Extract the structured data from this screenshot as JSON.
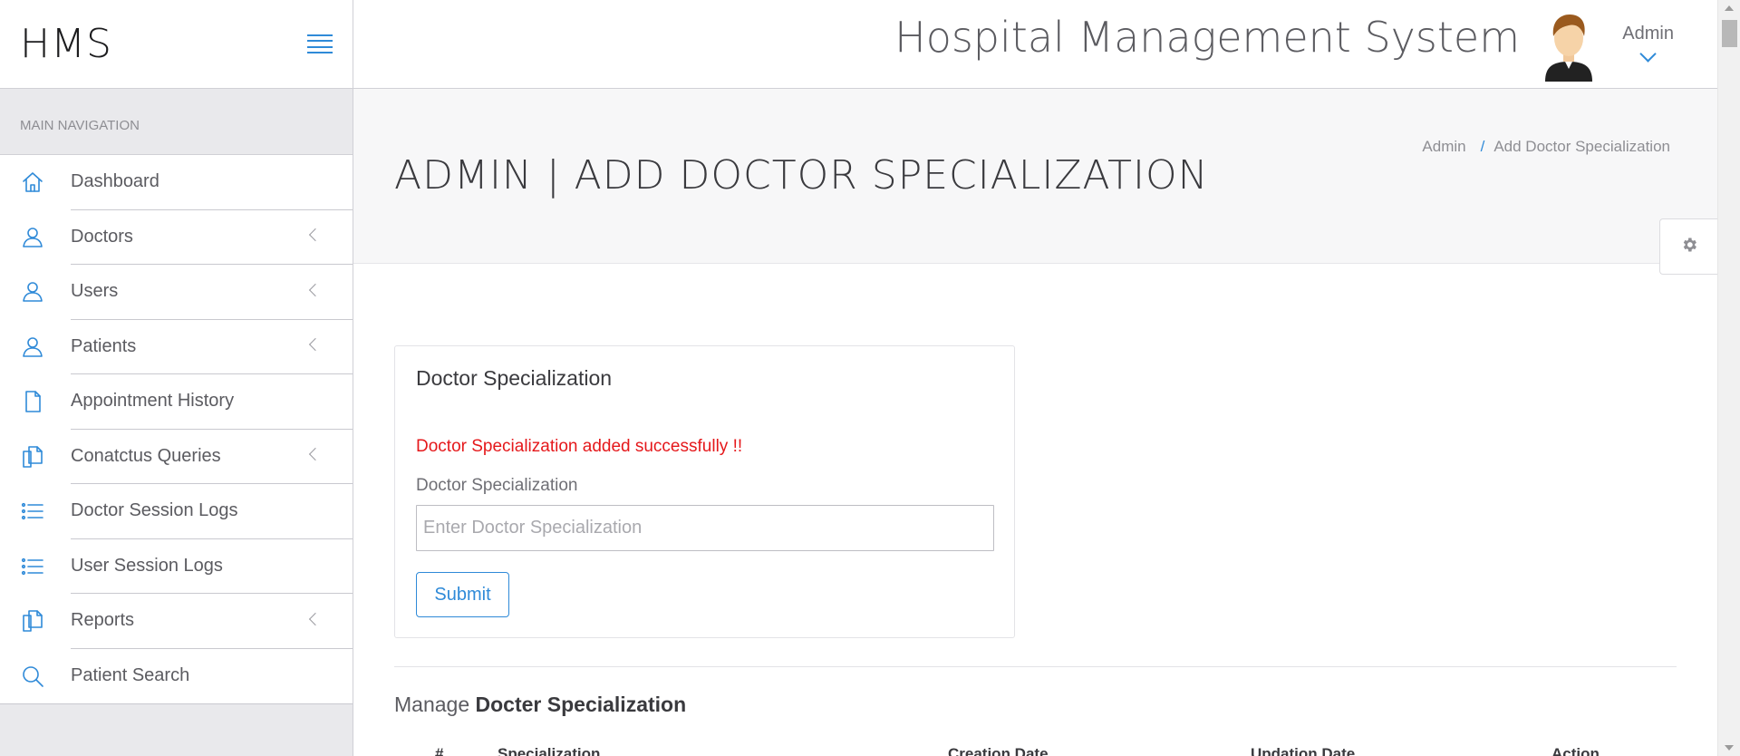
{
  "sidebar": {
    "brand": "HMS",
    "nav_heading": "MAIN NAVIGATION",
    "items": [
      {
        "label": "Dashboard",
        "icon": "home-icon"
      },
      {
        "label": "Doctors",
        "icon": "user-icon",
        "has_submenu": true
      },
      {
        "label": "Users",
        "icon": "user-icon",
        "has_submenu": true
      },
      {
        "label": "Patients",
        "icon": "user-icon",
        "has_submenu": true
      },
      {
        "label": "Appointment History",
        "icon": "file-icon"
      },
      {
        "label": "Conatctus Queries",
        "icon": "files-icon",
        "has_submenu": true
      },
      {
        "label": "Doctor Session Logs",
        "icon": "list-icon"
      },
      {
        "label": "User Session Logs",
        "icon": "list-icon"
      },
      {
        "label": "Reports",
        "icon": "files-icon",
        "has_submenu": true
      },
      {
        "label": "Patient Search",
        "icon": "search-icon"
      }
    ]
  },
  "header": {
    "app_title": "Hospital Management System",
    "user_name": "Admin"
  },
  "page": {
    "title": "ADMIN | ADD DOCTOR SPECIALIZATION",
    "breadcrumb": [
      "Admin",
      "Add Doctor Specialization"
    ]
  },
  "form": {
    "panel_title": "Doctor Specialization",
    "success_message": "Doctor Specialization added successfully !!",
    "field_label": "Doctor Specialization",
    "field_placeholder": "Enter Doctor Specialization",
    "field_value": "",
    "submit_label": "Submit"
  },
  "manage": {
    "heading_light": "Manage",
    "heading_strong": "Docter Specialization",
    "columns": [
      "#",
      "Specialization",
      "Creation Date",
      "Updation Date",
      "Action"
    ]
  },
  "colors": {
    "accent": "#2f8ad8",
    "success_text": "#e5181b"
  }
}
